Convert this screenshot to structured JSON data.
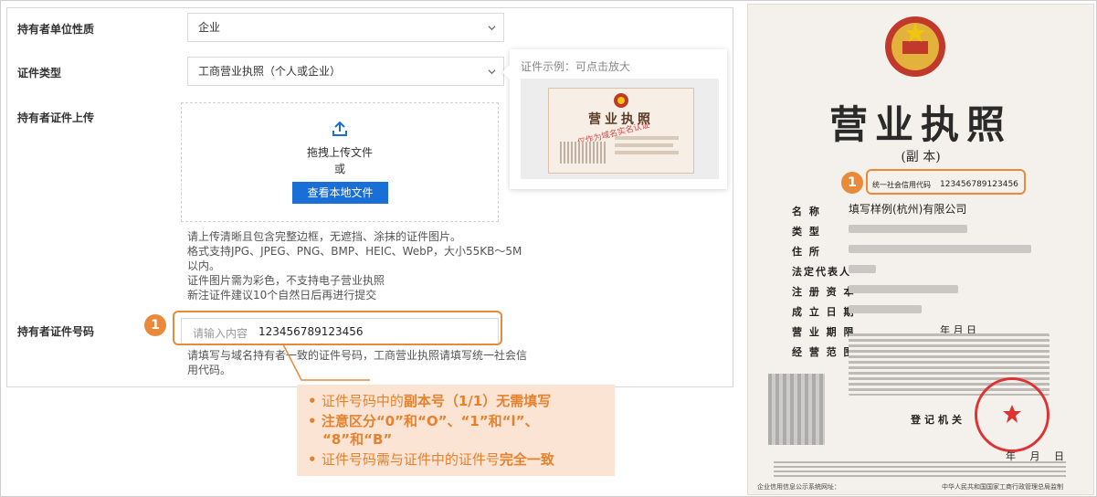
{
  "form": {
    "holder_type_label": "持有者单位性质",
    "holder_type_value": "企业",
    "cert_type_label": "证件类型",
    "cert_type_value": "工商营业执照（个人或企业）",
    "upload_label": "持有者证件上传",
    "upload_drag_text": "拖拽上传文件",
    "upload_or_text": "或",
    "upload_button": "查看本地文件",
    "upload_hints": [
      "请上传清晰且包含完整边框，无遮挡、涂抹的证件图片。",
      "格式支持JPG、JPEG、PNG、BMP、HEIC、WebP，大小55KB～5M",
      "以内。",
      "证件图片需为彩色，不支持电子营业执照",
      "新注证件建议10个自然日后再进行提交"
    ],
    "cert_number_label": "持有者证件号码",
    "cert_number_placeholder": "请输入内容",
    "cert_number_value": "123456789123456",
    "cert_number_hints": [
      "请填写与域名持有者一致的证件号码，工商营业执照请填写统一社会信",
      "用代码。"
    ]
  },
  "sample": {
    "title": "证件示例：可点击放大",
    "image_title": "营业执照",
    "watermark": "仅作为域名实名认证"
  },
  "annotation": {
    "badge_number": "1",
    "callout": [
      {
        "pre": "证件号码中的",
        "em": "副本号（1/1）无需填写",
        "post": ""
      },
      {
        "pre": "注意区分“0”和“O”、“1”和“l”、",
        "em": "",
        "post": ""
      },
      {
        "pre": "“8”和“B”",
        "em": "",
        "post": ""
      },
      {
        "pre": "证件号码需与证件中的证件号",
        "em": "完全一致",
        "post": ""
      }
    ],
    "bullet": "•"
  },
  "certificate": {
    "title": "营业执照",
    "subtitle": "(副 本)",
    "credit_code_label": "统一社会信用代码",
    "credit_code_value": "123456789123456",
    "fields": [
      {
        "label": "名 称",
        "value": "填写样例(杭州)有限公司"
      },
      {
        "label": "类 型",
        "value": ""
      },
      {
        "label": "住 所",
        "value": ""
      },
      {
        "label": "法定代表人",
        "value": ""
      },
      {
        "label": "注 册 资 本",
        "value": ""
      },
      {
        "label": "成 立 日 期",
        "value": ""
      },
      {
        "label": "营 业 期 限",
        "value": "年 月 日"
      },
      {
        "label": "经 营 范 围",
        "value": ""
      }
    ],
    "registration_office": "登记机关",
    "date_text": "年 月 日",
    "footer_left": "企业信用信息公示系统网址：",
    "footer_right": "中华人民共和国国家工商行政管理总局监制"
  },
  "colors": {
    "accent_orange": "#e88a3a",
    "primary_blue": "#1a6fd6",
    "callout_bg": "#fbe4d3"
  }
}
